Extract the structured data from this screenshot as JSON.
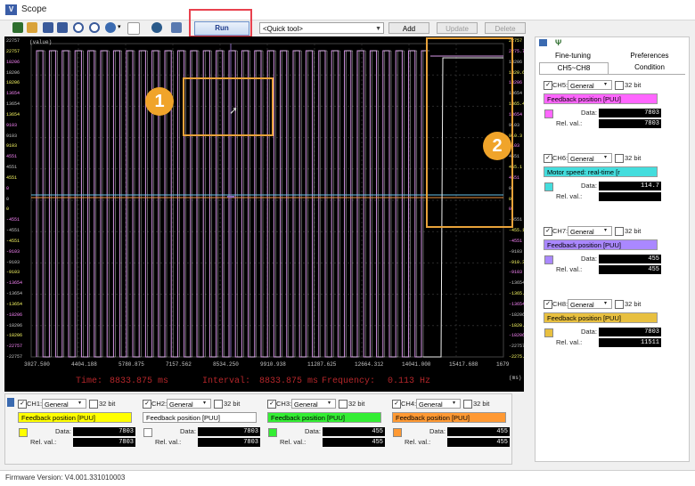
{
  "window": {
    "title": "Scope",
    "app_icon": "V"
  },
  "toolbar": {
    "icons": [
      "save-icon",
      "open-icon",
      "fit-icon",
      "fit-all-icon",
      "zoom-in-icon",
      "zoom-out-icon",
      "pan-icon",
      "dropdown-arrow-icon",
      "measure-icon",
      "settings-icon",
      "export-icon"
    ],
    "run_label": "Run",
    "quick_tool": "<Quick tool>",
    "add_label": "Add",
    "update_label": "Update",
    "delete_label": "Delete"
  },
  "plot": {
    "unit_label": "(value)",
    "y_ticks_left": [
      "22757",
      "22757",
      "18206",
      "18206",
      "18206",
      "13654",
      "13654",
      "13654",
      "9103",
      "9103",
      "9103",
      "4551",
      "4551",
      "4551",
      "0",
      "0",
      "0",
      "-4551",
      "-4551",
      "-4551",
      "-9103",
      "-9103",
      "-9103",
      "-13654",
      "-13654",
      "-13654",
      "-18206",
      "-18206",
      "-18206",
      "-22757",
      "-22757"
    ],
    "y_ticks_right": [
      "22757",
      "2275.7",
      "18206",
      "1820.6",
      "18206",
      "13654",
      "1365.4",
      "13654",
      "9103",
      "910.3",
      "9103",
      "4551",
      "455.1",
      "4551",
      "0",
      "0",
      "0",
      "-4551",
      "-455.1",
      "-4551",
      "-9103",
      "-910.3",
      "-9103",
      "-13654",
      "-1365.4",
      "-13654",
      "-18206",
      "-1820.6",
      "-18206",
      "-22757",
      "-2275.7"
    ],
    "x_ticks": [
      "3027.500",
      "4404.188",
      "5780.875",
      "7157.562",
      "8534.250",
      "9910.938",
      "11287.625",
      "12664.312",
      "14041.000",
      "15417.688",
      "1679"
    ],
    "x_unit": "(ms)",
    "status": {
      "time_label": "Time:",
      "time_value": "8833.875 ms",
      "interval_label": "Interval:",
      "interval_value": "8833.875 ms",
      "freq_label": "Frequency:",
      "freq_value": "0.113 Hz"
    }
  },
  "markers": [
    "1",
    "2"
  ],
  "channels_bottom": [
    {
      "name": "CH1:",
      "mode": "General",
      "bit": "32 bit",
      "source": "Feedback position [PUU]",
      "color": "#ffff00",
      "data_label": "Data:",
      "data": "7803",
      "rel_label": "Rel. val.:",
      "rel": "7803"
    },
    {
      "name": "CH2:",
      "mode": "General",
      "bit": "32 bit",
      "source": "Feedback position [PUU]",
      "color": "#ffffff",
      "data_label": "Data:",
      "data": "7803",
      "rel_label": "Rel. val.:",
      "rel": "7803"
    },
    {
      "name": "CH3:",
      "mode": "General",
      "bit": "32 bit",
      "source": "Feedback position [PUU]",
      "color": "#33ee33",
      "data_label": "Data:",
      "data": "455",
      "rel_label": "Rel. val.:",
      "rel": "455"
    },
    {
      "name": "CH4:",
      "mode": "General",
      "bit": "32 bit",
      "source": "Feedback position [PUU]",
      "color": "#ff9933",
      "data_label": "Data:",
      "data": "455",
      "rel_label": "Rel. val.:",
      "rel": "455"
    }
  ],
  "right_panel": {
    "tabs": [
      "Fine-tuning",
      "Preferences",
      "CH5~CH8",
      "Condition"
    ],
    "channels": [
      {
        "name": "CH5:",
        "mode": "General",
        "bit": "32 bit",
        "source": "Feedback position [PUU]",
        "color": "#ff66ff",
        "data_label": "Data:",
        "data": "7803",
        "rel_label": "Rel. val.:",
        "rel": "7803"
      },
      {
        "name": "CH6:",
        "mode": "General",
        "bit": "32 bit",
        "source": "Motor speed: real-time [r",
        "color": "#44dddd",
        "data_label": "Data:",
        "data": "114.7",
        "rel_label": "Rel. val.:",
        "rel": ""
      },
      {
        "name": "CH7:",
        "mode": "General",
        "bit": "32 bit",
        "source": "Feedback position [PUU]",
        "color": "#aa88ff",
        "data_label": "Data:",
        "data": "455",
        "rel_label": "Rel. val.:",
        "rel": "455"
      },
      {
        "name": "CH8:",
        "mode": "General",
        "bit": "32 bit",
        "source": "Feedback position [PUU]",
        "color": "#e8c040",
        "data_label": "Data:",
        "data": "7803",
        "rel_label": "Rel. val.:",
        "rel": "11511"
      }
    ]
  },
  "footer": {
    "firmware": "Firmware Version: V4.001.331010003"
  },
  "colors": {
    "run_highlight": "#e8414e",
    "marker": "#f0a42a",
    "plot_bg": "#000000",
    "status_text": "#b4262a"
  }
}
